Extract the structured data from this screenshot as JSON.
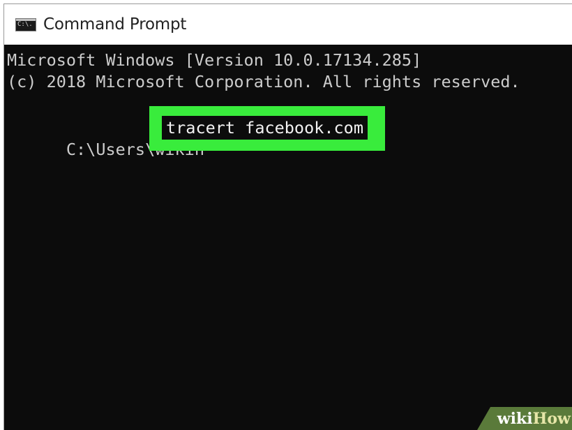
{
  "window": {
    "title": "Command Prompt",
    "icon": "cmd-icon",
    "icon_label": "C:\\."
  },
  "console": {
    "lines": [
      "Microsoft Windows [Version 10.0.17134.285]",
      "(c) 2018 Microsoft Corporation. All rights reserved."
    ],
    "prompt_path": "C:\\Users\\wikih",
    "command": "tracert facebook.com"
  },
  "watermark": {
    "wiki": "wiki",
    "how": "How"
  },
  "colors": {
    "background": "#0c0c0c",
    "text": "#cccccc",
    "highlight": "#39ec3c",
    "titlebar": "#ffffff"
  }
}
